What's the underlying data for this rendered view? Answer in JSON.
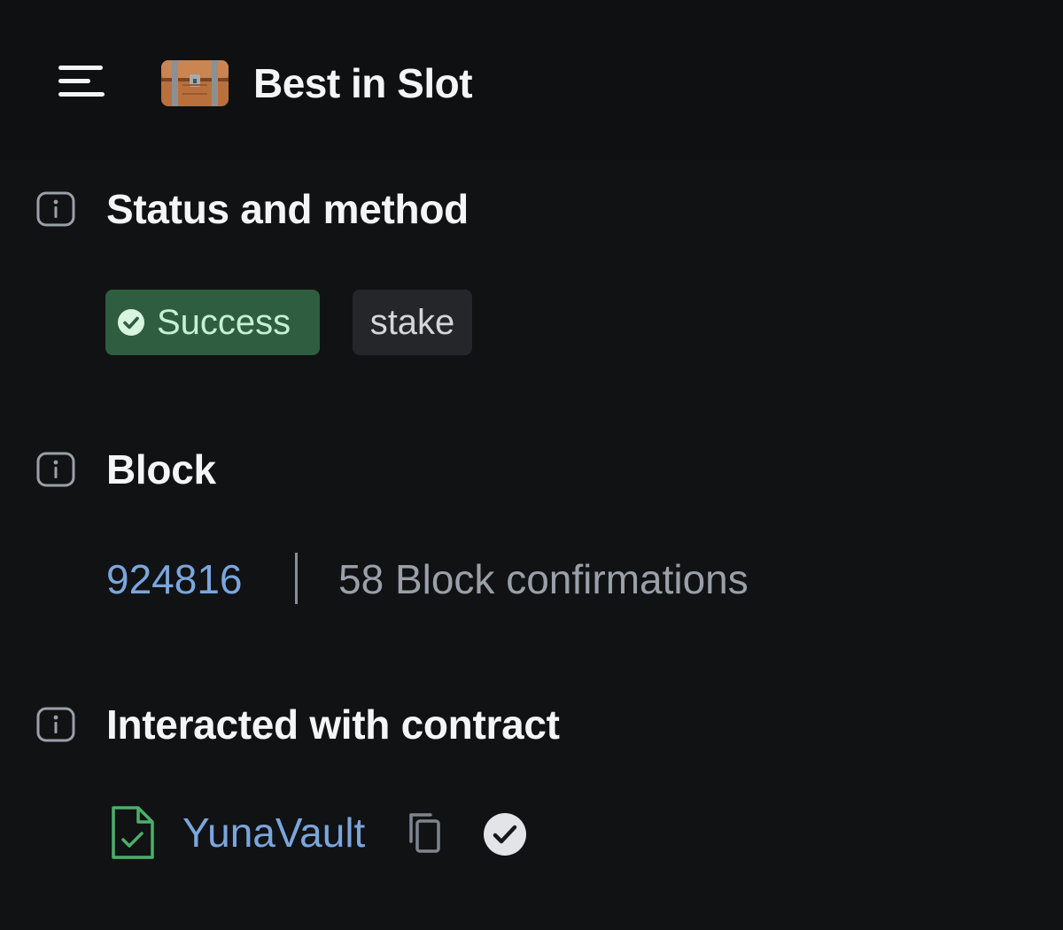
{
  "header": {
    "app_title": "Best in Slot",
    "menu_icon": "hamburger-menu-icon",
    "logo_icon": "treasure-chest-logo"
  },
  "status_section": {
    "title": "Status and method",
    "status_label": "Success",
    "status_color": "#2f5d3f",
    "method_label": "stake"
  },
  "block_section": {
    "title": "Block",
    "block_number": "924816",
    "confirmations": "58 Block confirmations"
  },
  "contract_section": {
    "title": "Interacted with contract",
    "contract_name": "YunaVault",
    "contract_icon": "contract-file-check-icon",
    "copy_icon": "copy-icon",
    "verified_icon": "verified-check-icon"
  },
  "colors": {
    "background": "#111214",
    "link": "#7ba6dc",
    "success_bg": "#2f5d3f",
    "muted_text": "#9aa0a8"
  }
}
